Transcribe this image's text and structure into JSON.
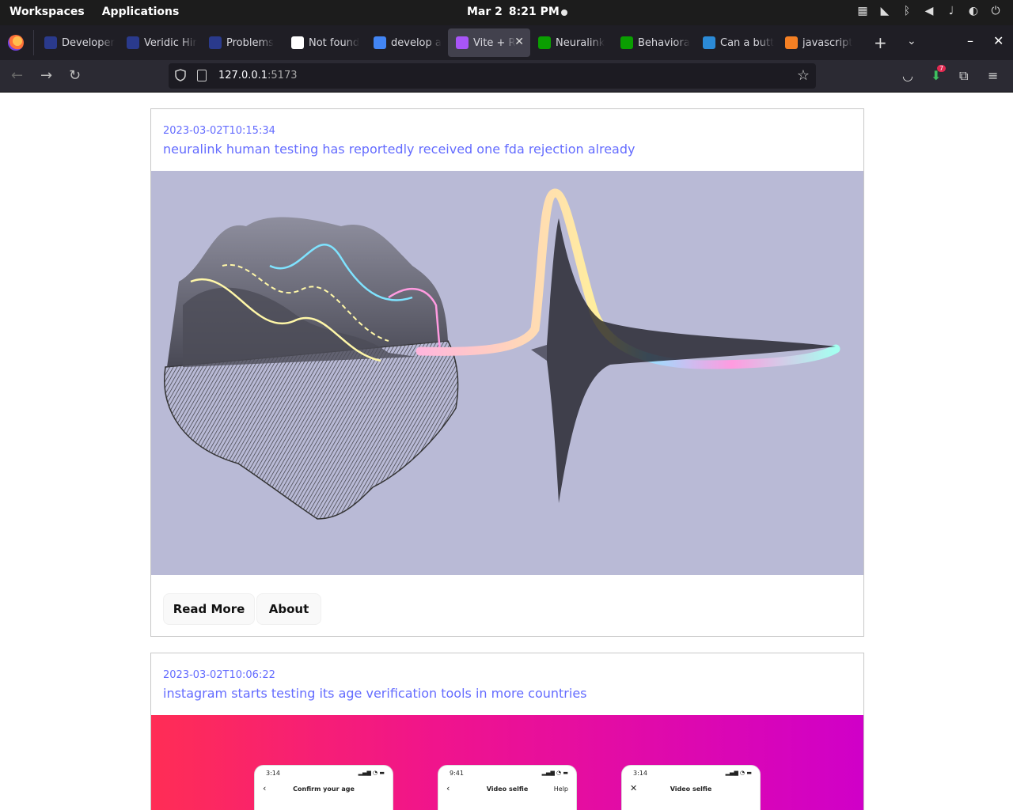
{
  "system_bar": {
    "workspaces": "Workspaces",
    "applications": "Applications",
    "date": "Mar 2",
    "time": "8:21 PM"
  },
  "browser": {
    "tabs": [
      {
        "label": "Developer",
        "icon": "generic-site-icon",
        "color": "#2a3a8c"
      },
      {
        "label": "Veridic Hir",
        "icon": "generic-site-icon",
        "color": "#2a3a8c"
      },
      {
        "label": "Problems",
        "icon": "generic-site-icon",
        "color": "#2a3a8c"
      },
      {
        "label": "Not found",
        "icon": "pen-icon",
        "color": "#ffffff"
      },
      {
        "label": "develop a",
        "icon": "google-icon",
        "color": "#4285f4"
      },
      {
        "label": "Vite + R",
        "icon": "vite-icon",
        "color": "#a855f7",
        "active": true
      },
      {
        "label": "Neuralink",
        "icon": "techcrunch-icon",
        "color": "#0a9e01"
      },
      {
        "label": "Behaviora",
        "icon": "techcrunch-icon",
        "color": "#0a9e01"
      },
      {
        "label": "Can a butt",
        "icon": "esri-icon",
        "color": "#2b8ad6"
      },
      {
        "label": "javascript",
        "icon": "stackoverflow-icon",
        "color": "#f48024"
      }
    ],
    "url_host": "127.0.0.1",
    "url_port": ":5173",
    "notification_count": "7"
  },
  "articles": [
    {
      "date": "2023-03-02T10:15:34",
      "title": "neuralink human testing has reportedly received one fda rejection already",
      "image_bg": "#b9bad6",
      "read_more": "Read More",
      "about": "About"
    },
    {
      "date": "2023-03-02T10:06:22",
      "title": "instagram starts testing its age verification tools in more countries",
      "screens": [
        {
          "time": "3:14",
          "heading": "Confirm your age",
          "nav": "‹",
          "help": ""
        },
        {
          "time": "9:41",
          "heading": "Video selfie",
          "nav": "‹",
          "help": "Help"
        },
        {
          "time": "3:14",
          "heading": "Video selfie",
          "nav": "✕",
          "help": ""
        }
      ]
    }
  ]
}
